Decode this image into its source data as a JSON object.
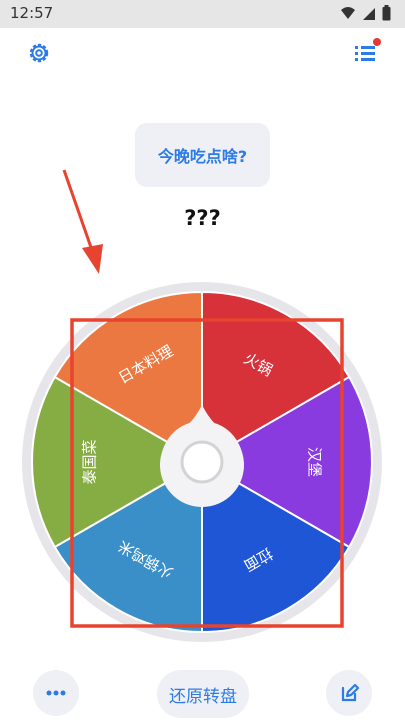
{
  "status_bar": {
    "time": "12:57"
  },
  "header": {
    "settings_icon": "gear-icon",
    "list_icon": "list-icon",
    "notification_dot_color": "#e53935"
  },
  "prompt": {
    "question": "今晚吃点啥?"
  },
  "result": {
    "text": "???"
  },
  "wheel": {
    "slices": [
      {
        "label": "火锅",
        "color": "#d7313a"
      },
      {
        "label": "汉堡",
        "color": "#8a3be0"
      },
      {
        "label": "拉面",
        "color": "#1f56d6"
      },
      {
        "label": "火锅鸡米",
        "color": "#3a8fc8"
      },
      {
        "label": "泰国菜",
        "color": "#86ad43"
      },
      {
        "label": "日本料理",
        "color": "#ec7841"
      }
    ],
    "border_color": "#e6e6ea"
  },
  "annotation": {
    "arrow_color": "#e8432e",
    "box_color": "#e8432e"
  },
  "bottom": {
    "more_icon": "more-dots-icon",
    "reset_label": "还原转盘",
    "edit_icon": "edit-icon"
  },
  "accent": "#2d7be5"
}
